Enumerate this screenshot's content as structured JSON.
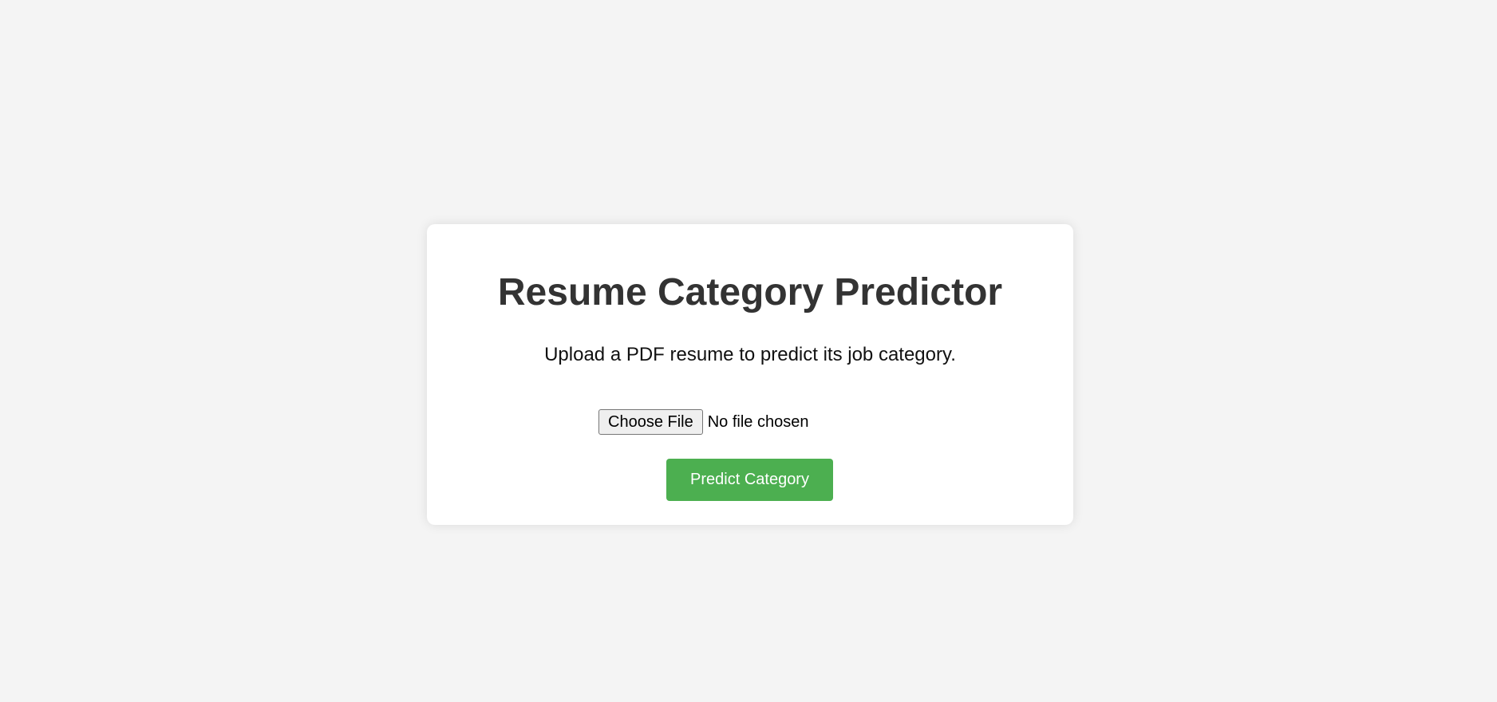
{
  "page": {
    "title": "Resume Category Predictor",
    "subtitle": "Upload a PDF resume to predict its job category."
  },
  "upload": {
    "choose_label": "Choose File",
    "status": "No file chosen"
  },
  "actions": {
    "predict_label": "Predict Category"
  },
  "colors": {
    "background": "#f4f4f4",
    "card": "#ffffff",
    "title": "#333333",
    "button": "#4caf50"
  }
}
